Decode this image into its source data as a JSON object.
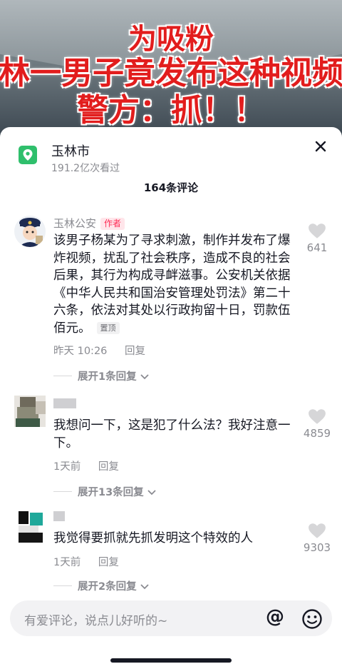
{
  "video": {
    "headline_line1": "为吸粉",
    "headline_line2": "林一男子竟发布这种视频",
    "headline_line3": "警方：抓！！"
  },
  "topic": {
    "title": "玉林市",
    "views": "191.2亿次看过",
    "icon": "location-pin-icon"
  },
  "comment_count": "164条评论",
  "comments": [
    {
      "user": "玉林公安",
      "badge": "作者",
      "text": "该男子杨某为了寻求刺激，制作并发布了爆炸视频，扰乱了社会秩序，造成不良的社会后果，其行为构成寻衅滋事。公安机关依据《中华人民共和国治安管理处罚法》第二十六条，依法对其处以行政拘留十日，罚款伍佰元。",
      "pin": "置顶",
      "time": "昨天 10:26",
      "reply": "回复",
      "likes": "641",
      "expand": "展开1条回复"
    },
    {
      "user": "",
      "text": "我想问一下，这是犯了什么法？我好注意一下。",
      "time": "1天前",
      "reply": "回复",
      "likes": "4859",
      "expand": "展开13条回复"
    },
    {
      "user": "",
      "text": "我觉得要抓就先抓发明这个特效的人",
      "time": "1天前",
      "reply": "回复",
      "likes": "9303",
      "expand": "展开2条回复"
    }
  ],
  "input": {
    "placeholder": "有爱评论，说点儿好听的~",
    "at_symbol": "@"
  },
  "colors": {
    "accent_red": "#fe2c55",
    "location_green": "#2fbf6c",
    "muted_text": "#8a8b91"
  }
}
